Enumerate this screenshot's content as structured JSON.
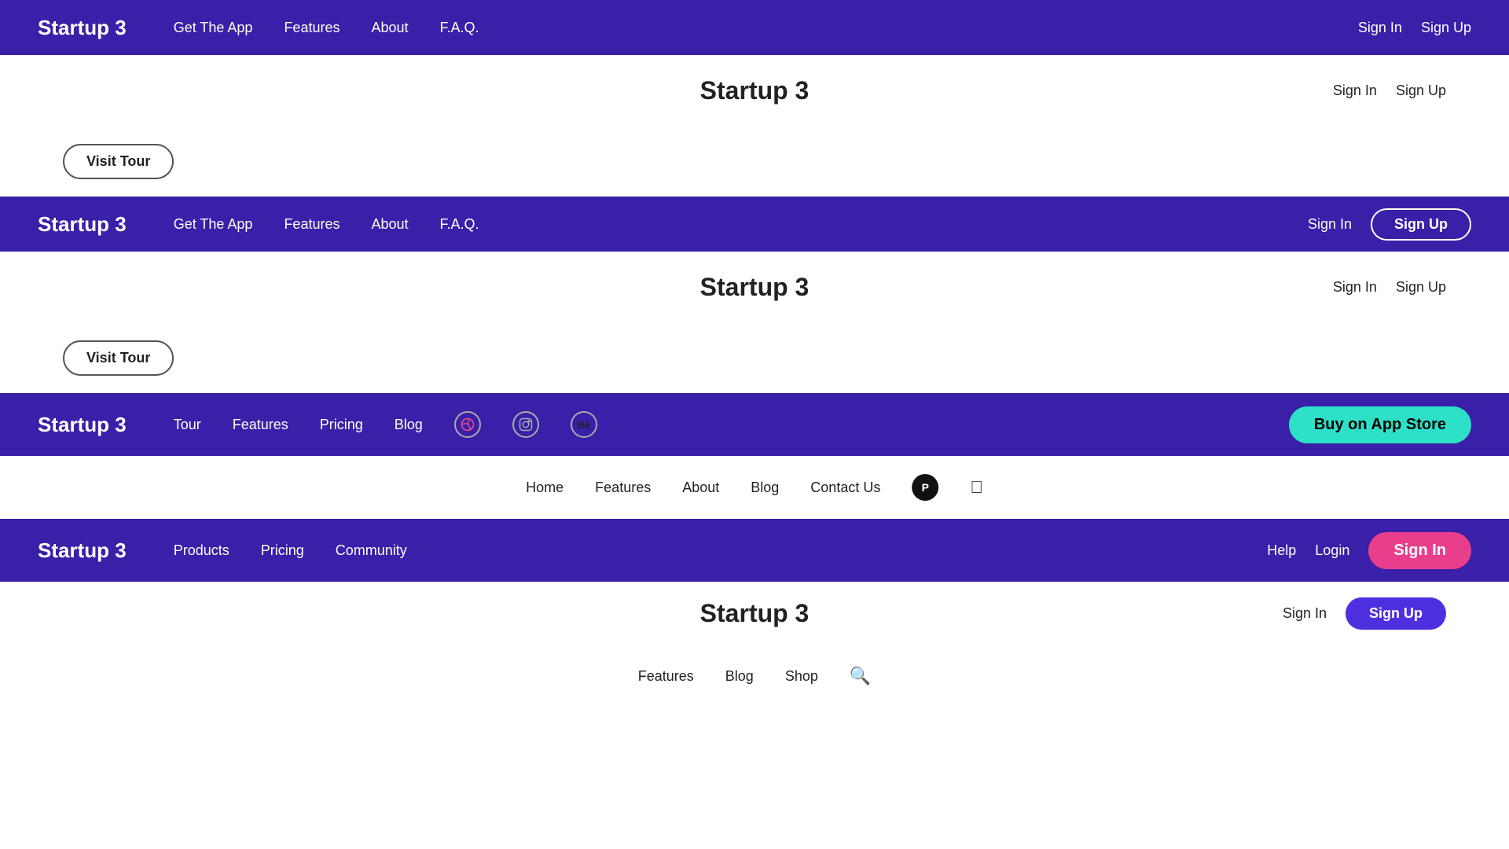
{
  "navbars": [
    {
      "id": "nav1",
      "theme": "dark",
      "brand": "Startup 3",
      "links": [
        "Get The App",
        "Features",
        "About",
        "F.A.Q."
      ],
      "actions": [
        {
          "label": "Sign In",
          "type": "text"
        },
        {
          "label": "Sign Up",
          "type": "text"
        }
      ]
    },
    {
      "id": "content1",
      "type": "content",
      "theme": "light",
      "center": "Startup 3",
      "left_button": null,
      "right": [
        {
          "label": "Sign In",
          "type": "text"
        },
        {
          "label": "Sign Up",
          "type": "text"
        }
      ]
    },
    {
      "id": "content2",
      "type": "content",
      "theme": "light",
      "center": null,
      "left_button": "Visit Tour",
      "right": []
    },
    {
      "id": "nav2",
      "theme": "dark",
      "brand": "Startup 3",
      "links": [
        "Get The App",
        "Features",
        "About",
        "F.A.Q."
      ],
      "actions": [
        {
          "label": "Sign In",
          "type": "text"
        },
        {
          "label": "Sign Up",
          "type": "outline"
        }
      ]
    },
    {
      "id": "content3",
      "type": "content",
      "theme": "light",
      "center": "Startup 3",
      "left_button": null,
      "right": [
        {
          "label": "Sign In",
          "type": "text"
        },
        {
          "label": "Sign Up",
          "type": "text"
        }
      ]
    },
    {
      "id": "content4",
      "type": "content",
      "theme": "light",
      "center": null,
      "left_button": "Visit Tour",
      "right": []
    },
    {
      "id": "nav3",
      "theme": "dark",
      "brand": "Startup 3",
      "links": [
        "Tour",
        "Features",
        "Pricing",
        "Blog"
      ],
      "socials": [
        "dribbble",
        "instagram",
        "behance"
      ],
      "actions": [
        {
          "label": "Buy on App Store",
          "type": "teal"
        }
      ]
    },
    {
      "id": "content5",
      "type": "content",
      "theme": "light",
      "center": null,
      "left_button": null,
      "right": [],
      "links_center": [
        "Home",
        "Features",
        "About",
        "Blog",
        "Contact Us"
      ],
      "socials": [
        "producthunt",
        "apple"
      ]
    },
    {
      "id": "nav4",
      "theme": "dark",
      "brand": "Startup 3",
      "links": [
        "Products",
        "Pricing",
        "Community"
      ],
      "actions": [
        {
          "label": "Help",
          "type": "text"
        },
        {
          "label": "Login",
          "type": "text"
        },
        {
          "label": "Sign In",
          "type": "pink"
        }
      ]
    },
    {
      "id": "content6",
      "type": "content",
      "theme": "light",
      "center": "Startup 3",
      "left_button": null,
      "right": [
        {
          "label": "Sign In",
          "type": "text"
        },
        {
          "label": "Sign Up",
          "type": "purple"
        }
      ]
    },
    {
      "id": "content7",
      "type": "content",
      "theme": "light",
      "center": null,
      "left_button": null,
      "links_center": [
        "Features",
        "Blog",
        "Shop"
      ],
      "has_search": true,
      "right": []
    }
  ],
  "labels": {
    "visit_tour": "Visit Tour",
    "buy_app_store": "Buy on App Store",
    "sign_in": "Sign In",
    "sign_up": "Sign Up",
    "login": "Login",
    "help": "Help"
  }
}
